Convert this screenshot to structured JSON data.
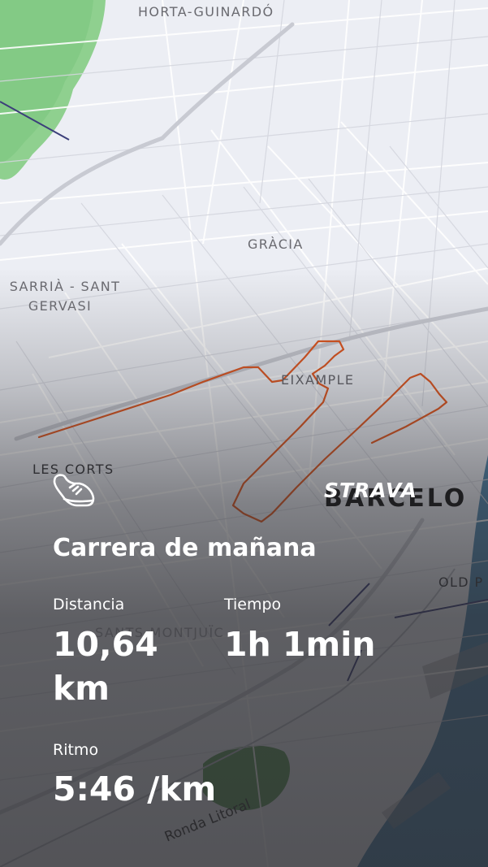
{
  "map": {
    "labels": {
      "horta_guinardo": "HORTA-GUINARDÓ",
      "gracia": "GRÀCIA",
      "sarria_line1": "SARRIÀ - SANT",
      "sarria_line2": "GERVASI",
      "eixample": "EIXAMPLE",
      "les_corts": "LES CORTS",
      "barcelona": "BARCELO",
      "old_port": "OLD P",
      "sants_montjuic": "SANTS-MONTJUÏC",
      "ronda_litoral": "Ronda Litoral"
    },
    "route_color": "#e0561f"
  },
  "brand": {
    "logo_text": "STRAVA"
  },
  "activity": {
    "icon": "running-shoe-icon",
    "title": "Carrera de mañana",
    "stats": {
      "distance": {
        "label": "Distancia",
        "value": "10,64 km"
      },
      "time": {
        "label": "Tiempo",
        "value": "1h 1min"
      },
      "pace": {
        "label": "Ritmo",
        "value": "5:46 /km"
      }
    }
  }
}
